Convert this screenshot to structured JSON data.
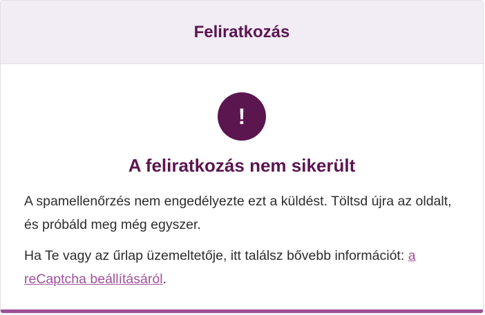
{
  "header": {
    "title": "Feliratkozás"
  },
  "alert": {
    "icon_symbol": "!",
    "icon_name": "exclamation-icon",
    "title": "A feliratkozás nem sikerült",
    "message": "A spamellenőrzés nem engedélyezte ezt a küldést. Töltsd újra az oldalt, és próbáld meg még egyszer.",
    "operator_text": "Ha Te vagy az űrlap üzemeltetője, itt találsz bővebb információt: ",
    "link_text": "a reCaptcha beállításáról",
    "after_link": "."
  },
  "colors": {
    "brand": "#5b1650",
    "link": "#a0509a",
    "header_bg": "#f2ecf4",
    "bottom_bar": "#9e4e97"
  }
}
